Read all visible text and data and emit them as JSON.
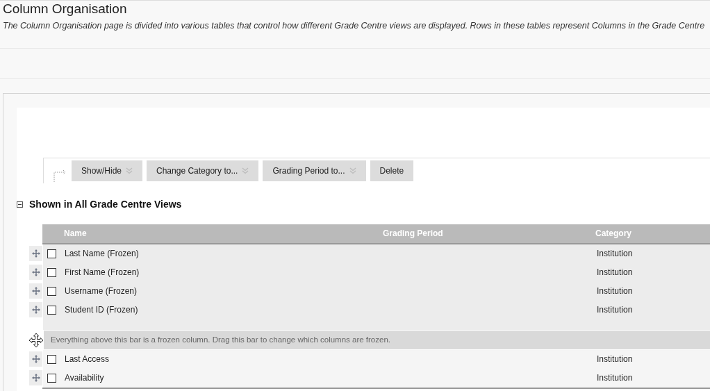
{
  "page": {
    "title": "Column Organisation",
    "description": "The Column Organisation page is divided into various tables that control how different Grade Centre views are displayed. Rows in these tables represent Columns in the Grade Centre"
  },
  "toolbar": {
    "buttons": [
      {
        "label": "Show/Hide",
        "has_menu": true
      },
      {
        "label": "Change Category to...",
        "has_menu": true
      },
      {
        "label": "Grading Period to...",
        "has_menu": true
      },
      {
        "label": "Delete",
        "has_menu": false
      }
    ]
  },
  "section": {
    "title": "Shown in All Grade Centre Views",
    "expanded": true,
    "columns": [
      "Name",
      "Grading Period",
      "Category"
    ],
    "frozen_rows": [
      {
        "name": "Last Name (Frozen)",
        "category": "Institution",
        "checked": false
      },
      {
        "name": "First Name (Frozen)",
        "category": "Institution",
        "checked": false
      },
      {
        "name": "Username (Frozen)",
        "category": "Institution",
        "checked": false
      },
      {
        "name": "Student ID (Frozen)",
        "category": "Institution",
        "checked": false
      }
    ],
    "frozen_bar": "Everything above this bar is a frozen column. Drag this bar to change which columns are frozen.",
    "rows": [
      {
        "name": "Last Access",
        "category": "Institution",
        "checked": false
      },
      {
        "name": "Availability",
        "category": "Institution",
        "checked": false
      }
    ]
  }
}
